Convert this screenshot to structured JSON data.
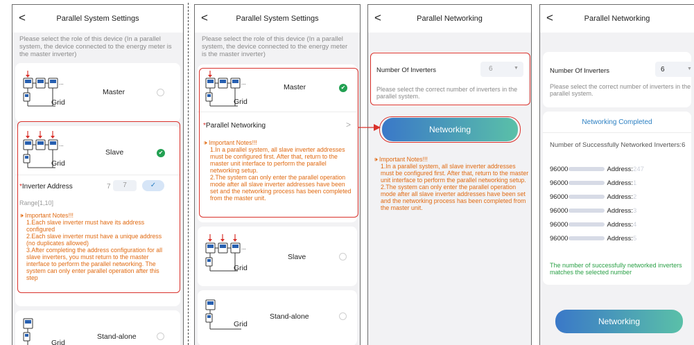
{
  "p1": {
    "back": "<",
    "title": "Parallel System Settings",
    "hint": "Please select the role of this device (In a parallel system, the device connected to the energy meter is the master inverter)",
    "grid_label": "Grid",
    "master_label": "Master",
    "slave_label": "Slave",
    "standalone_label": "Stand-alone",
    "addr_star": "*",
    "addr_label": "Inverter Address",
    "addr_value": "7",
    "addr_input": "7",
    "addr_range": "Range[1,10]",
    "notes_title": "Important Notes!!!",
    "notes": [
      "1.Each slave inverter must have its address configured",
      "2.Each slave inverter must have a unique address (no duplicates allowed)",
      "3.After completing the address configuration for all slave inverters, you must return to the master interface to perform the parallel networking. The system can only enter parallel operation after this step"
    ]
  },
  "p2": {
    "back": "<",
    "title": "Parallel System Settings",
    "hint": "Please select the role of this device (In a parallel system, the device connected to the energy meter is the master inverter)",
    "grid_label": "Grid",
    "master_label": "Master",
    "slave_label": "Slave",
    "standalone_label": "Stand-alone",
    "pn_star": "*",
    "pn_label": "Parallel Networking",
    "chevron": ">",
    "notes_title": "Important Notes!!!",
    "notes": [
      "1.In a parallel system, all slave inverter addresses must be configured first. After that, return to the master unit interface to perform the parallel networking setup.",
      "2.The system can only enter the parallel operation mode after all slave inverter addresses have been set and the networking process has been completed from the master unit."
    ]
  },
  "p3": {
    "back": "<",
    "title": "Parallel Networking",
    "count_label": "Number Of Inverters",
    "count_value": "6",
    "hint": "Please select the correct number of inverters in the parallel system.",
    "button": "Networking",
    "notes_title": "Important Notes!!!",
    "notes": [
      "1.In a parallel system, all slave inverter addresses must be configured first. After that, return to the master unit interface to perform the parallel networking setup.",
      "2.The system can only enter the parallel operation mode after all slave inverter addresses have been set and the networking process has been completed from the master unit."
    ]
  },
  "p4": {
    "back": "<",
    "title": "Parallel Networking",
    "count_label": "Number Of Inverters",
    "count_value": "6",
    "hint": "Please select the correct number of inverters in the parallel system.",
    "completed": "Networking Completed",
    "success_label": "Number of Successfully Networked Inverters:6",
    "devices": [
      {
        "prefix": "96000",
        "address_label": "Address:",
        "address_value": "247"
      },
      {
        "prefix": "96000",
        "address_label": "Address:",
        "address_value": "1"
      },
      {
        "prefix": "96000",
        "address_label": "Address:",
        "address_value": "2"
      },
      {
        "prefix": "96000",
        "address_label": "Address:",
        "address_value": "3"
      },
      {
        "prefix": "96000",
        "address_label": "Address:",
        "address_value": "4"
      },
      {
        "prefix": "96000",
        "address_label": "Address:",
        "address_value": "5"
      }
    ],
    "match_text": "The number of successfully networked inverters matches the selected number",
    "button": "Networking"
  },
  "colors": {
    "red_box": "#d9312b",
    "orange_note": "#e06a12",
    "check_green": "#22a052",
    "success_green": "#2aa046",
    "title_blue": "#2b7fc2",
    "button_start": "#3a78c8",
    "button_end": "#5ac0a8"
  },
  "icons": [
    "inverter-diagram-icon",
    "radio-unchecked-icon",
    "check-circle-icon",
    "speaker-icon",
    "chevron-right-icon",
    "dropdown-arrow-icon",
    "arrow-right-icon"
  ]
}
